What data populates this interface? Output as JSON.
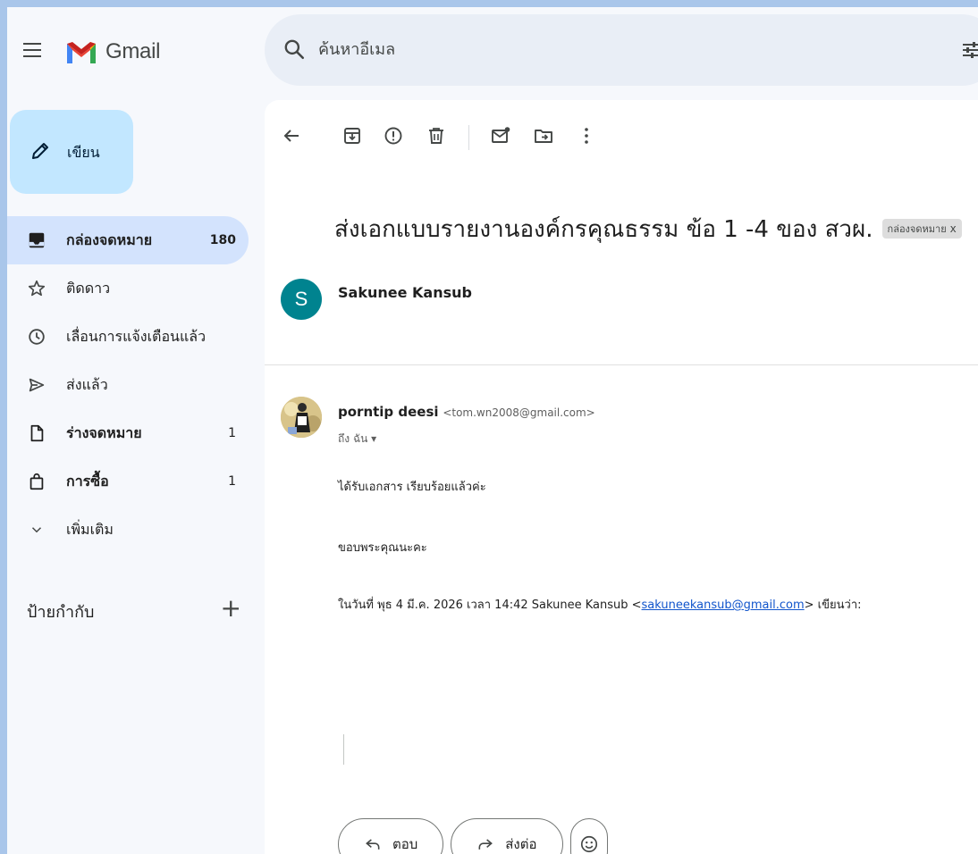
{
  "app": {
    "name": "Gmail"
  },
  "search": {
    "placeholder": "ค้นหาอีเมล"
  },
  "sidebar": {
    "compose_label": "เขียน",
    "items": [
      {
        "label": "กล่องจดหมาย",
        "count": "180",
        "icon": "inbox-icon"
      },
      {
        "label": "ติดดาว",
        "count": "",
        "icon": "star-icon"
      },
      {
        "label": "เลื่อนการแจ้งเตือนแล้ว",
        "count": "",
        "icon": "snooze-icon"
      },
      {
        "label": "ส่งแล้ว",
        "count": "",
        "icon": "send-icon"
      },
      {
        "label": "ร่างจดหมาย",
        "count": "1",
        "icon": "draft-icon"
      },
      {
        "label": "การซื้อ",
        "count": "1",
        "icon": "shopping-bag-icon"
      },
      {
        "label": "เพิ่มเติม",
        "count": "",
        "icon": "chevron-down-icon"
      }
    ],
    "labels_title": "ป้ายกำกับ",
    "labels_add": "+"
  },
  "email": {
    "subject": "ส่งเอกแบบรายงานองค์กรคุณธรรม ข้อ 1 -4 ของ สวผ.",
    "tag": "กล่องจดหมาย",
    "tag_close": "x",
    "first_sender": {
      "initial": "S",
      "name": "Sakunee Kansub"
    },
    "reply": {
      "sender_name": "porntip deesi",
      "sender_email": "<tom.wn2008@gmail.com>",
      "to_me": "ถึง ฉัน ▾",
      "line1": "ได้รับเอกสาร เรียบร้อยแล้วค่ะ",
      "line2": "ขอบพระคุณนะคะ",
      "quote_prefix": "ในวันที่ พุธ 4 มี.ค. 2026 เวลา 14:42 Sakunee Kansub <",
      "quote_email": "sakuneekansub@gmail.com",
      "quote_suffix": "> เขียนว่า:"
    },
    "actions": {
      "reply_label": "ตอบ",
      "forward_label": "ส่งต่อ"
    }
  },
  "colors": {
    "compose_bg": "#c2e7ff",
    "active_nav_bg": "#d3e3fd",
    "avatar_s_bg": "#00838f",
    "link": "#1155cc"
  }
}
